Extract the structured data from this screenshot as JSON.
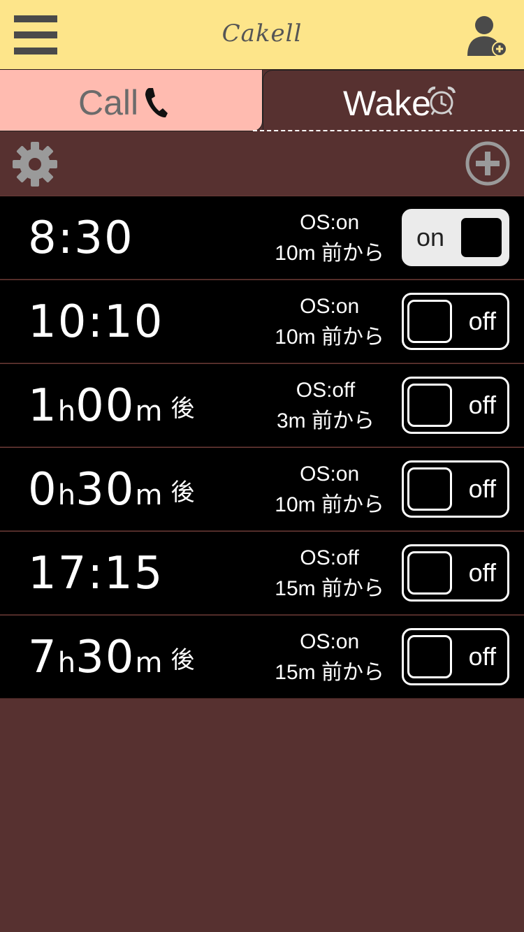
{
  "header": {
    "title": "Cakell"
  },
  "tabs": [
    {
      "label": "Call"
    },
    {
      "label": "Wake"
    }
  ],
  "alarms": [
    {
      "time": "8:30",
      "os": "OS:on",
      "before": "10m 前から",
      "toggle": "on"
    },
    {
      "time": "10:10",
      "os": "OS:on",
      "before": "10m 前から",
      "toggle": "off"
    },
    {
      "hours": "1",
      "h": "h",
      "minutes": "00",
      "m": "m",
      "suffix": "後",
      "os": "OS:off",
      "before": "3m 前から",
      "toggle": "off"
    },
    {
      "hours": "0",
      "h": "h",
      "minutes": "30",
      "m": "m",
      "suffix": "後",
      "os": "OS:on",
      "before": "10m 前から",
      "toggle": "off"
    },
    {
      "time": "17:15",
      "os": "OS:off",
      "before": "15m 前から",
      "toggle": "off"
    },
    {
      "hours": "7",
      "h": "h",
      "minutes": "30",
      "m": "m",
      "suffix": "後",
      "os": "OS:on",
      "before": "15m 前から",
      "toggle": "off"
    }
  ],
  "icons": {
    "menu": "hamburger-menu-icon",
    "add_user": "add-user-icon",
    "phone": "phone-icon",
    "alarm_clock": "alarm-clock-icon",
    "settings": "gear-icon",
    "add": "plus-circle-icon"
  },
  "colors": {
    "header_bg": "#fde58a",
    "call_tab_bg": "#ffbbb0",
    "main_bg": "#573130",
    "row_bg": "#000000"
  }
}
